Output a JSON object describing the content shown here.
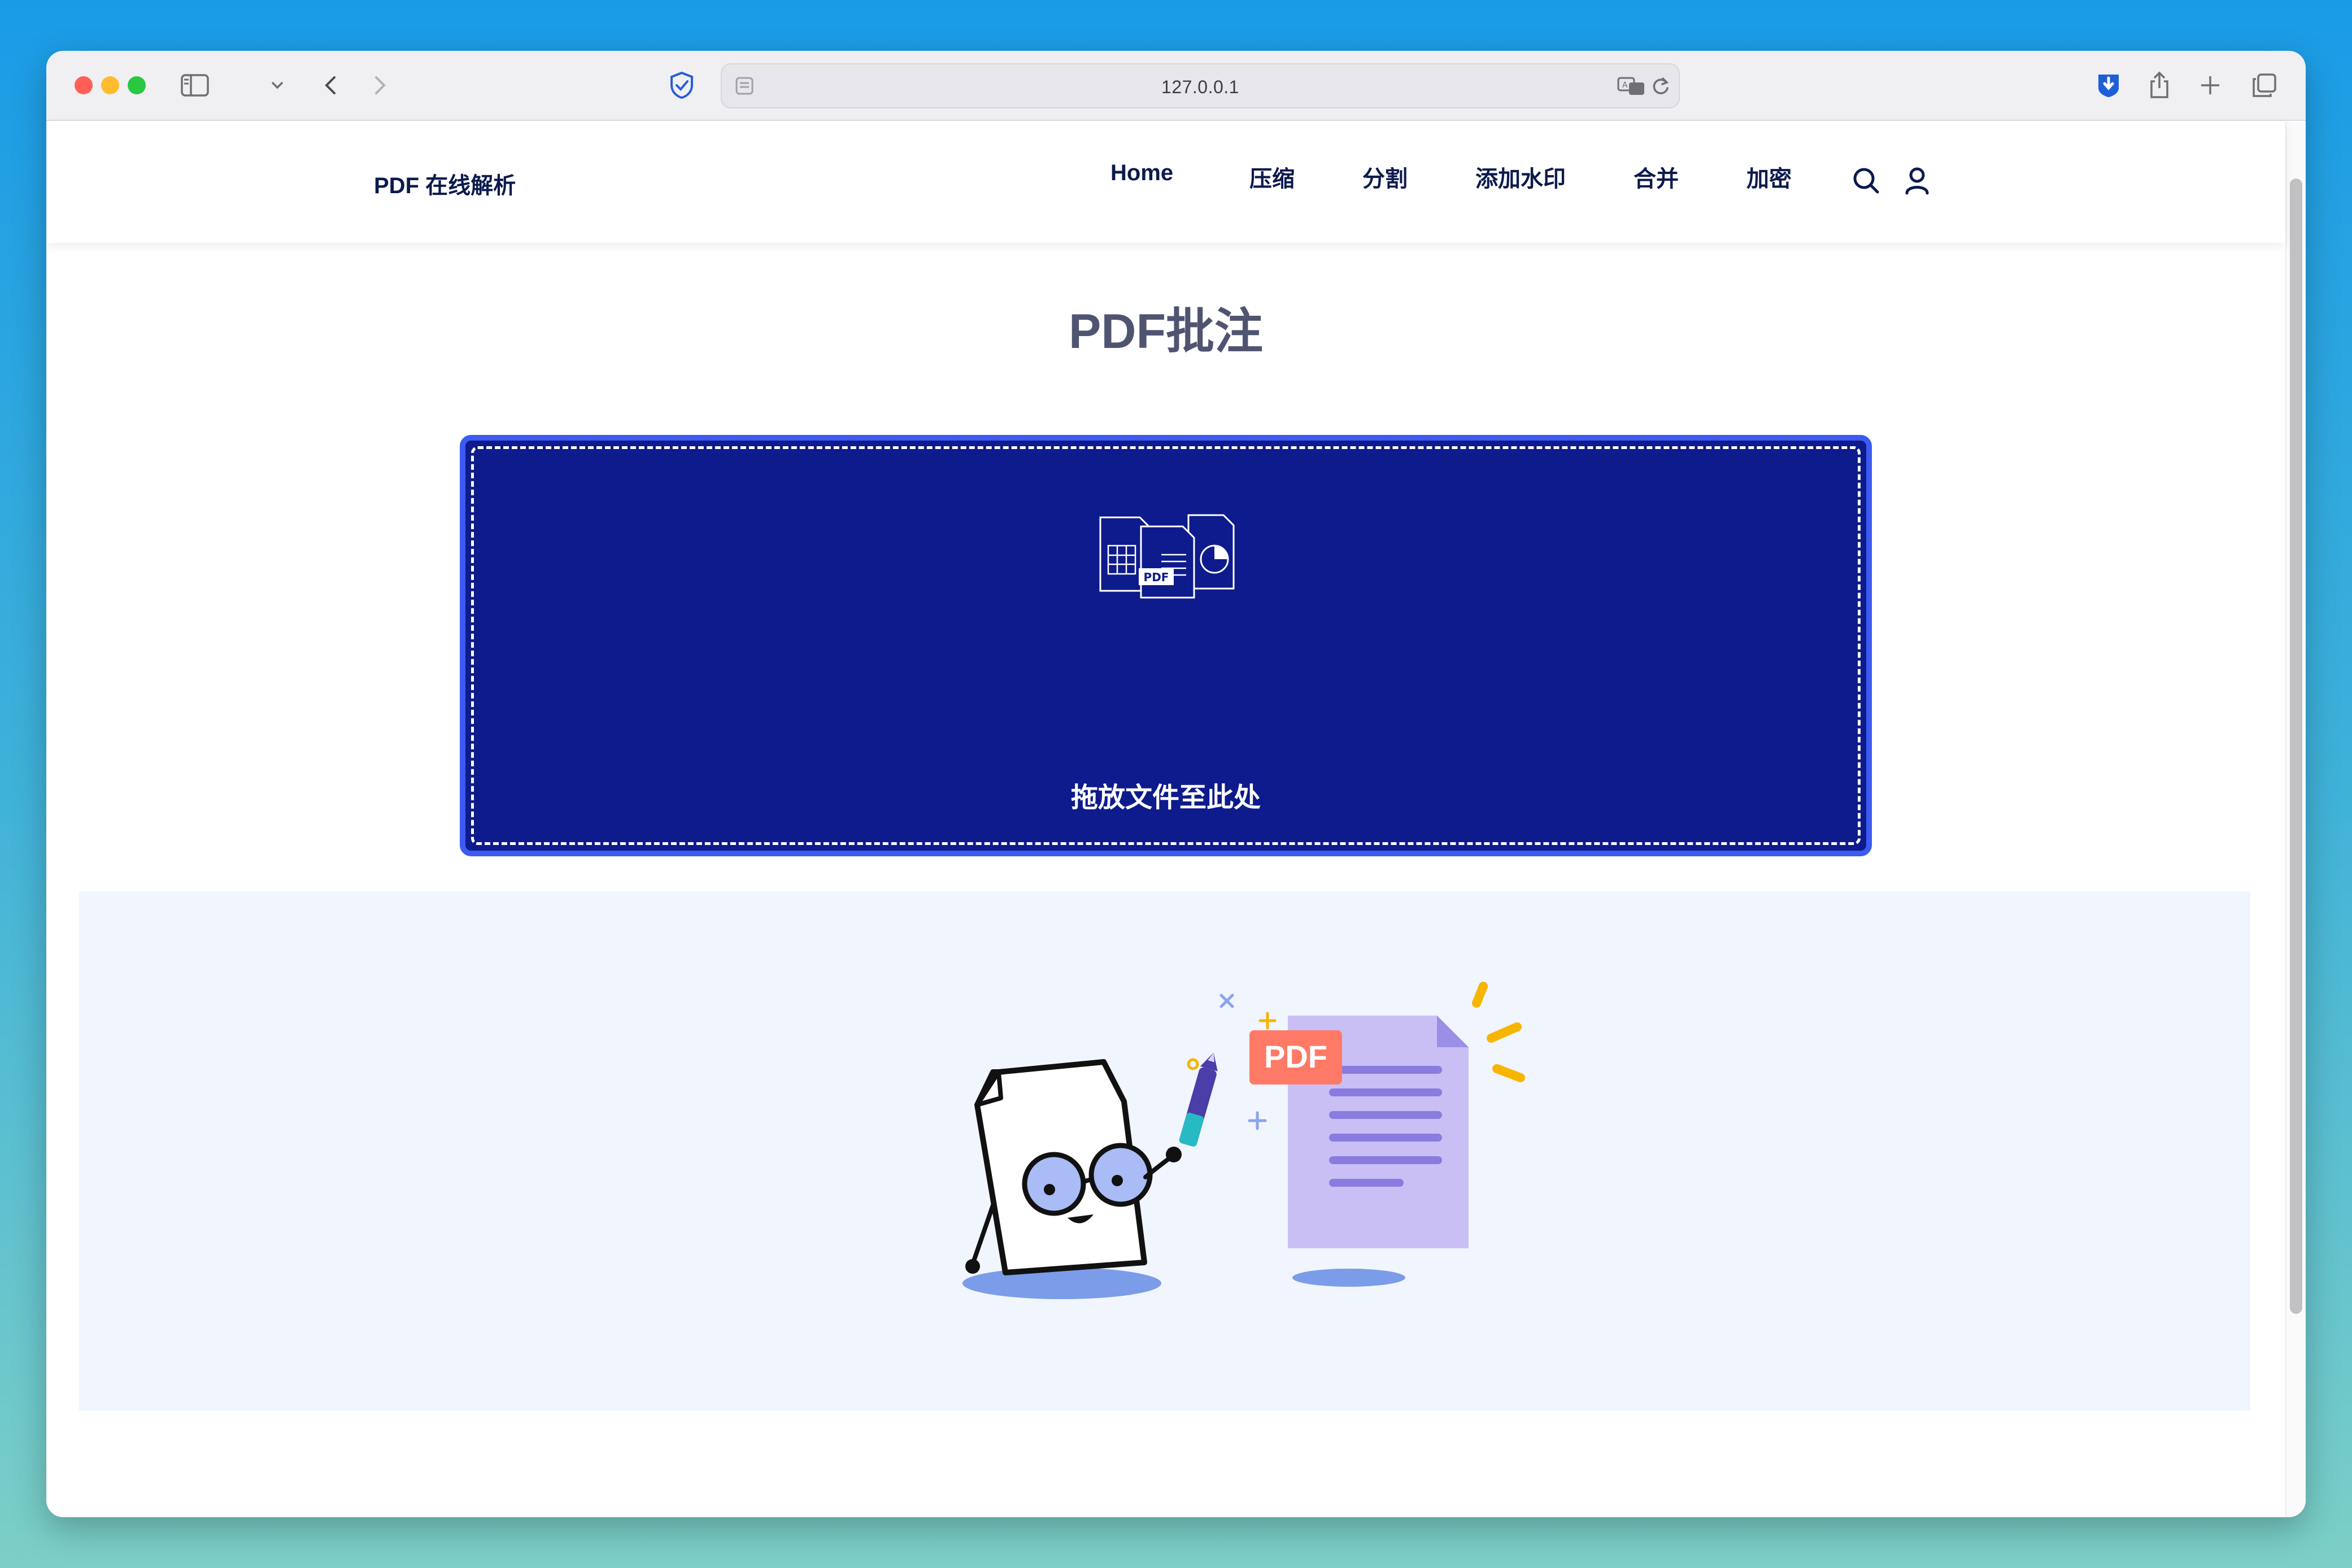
{
  "browser": {
    "url": "127.0.0.1",
    "traffic_colors": [
      "#ff5f57",
      "#febc2e",
      "#28c840"
    ]
  },
  "site": {
    "logo": "PDF 在线解析",
    "nav": [
      "Home",
      "压缩",
      "分割",
      "添加水印",
      "合并",
      "加密"
    ]
  },
  "main": {
    "title": "PDF批注",
    "drop_text": "拖放文件至此处",
    "drop_icon_badge": "PDF"
  },
  "illustration": {
    "badge": "PDF"
  },
  "colors": {
    "accent": "#3d5af1",
    "dropzone_bg": "#0e1b8c",
    "nav_text": "#0c1a4d",
    "badge": "#ff7a66",
    "document": "#c9bff5"
  }
}
